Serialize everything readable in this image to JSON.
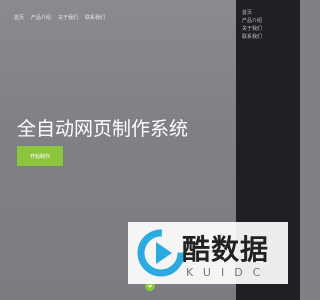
{
  "top_nav": {
    "items": [
      {
        "label": "首页"
      },
      {
        "label": "产品介绍"
      },
      {
        "label": "关于我们"
      },
      {
        "label": "联系我们"
      }
    ]
  },
  "hero": {
    "title": "全自动网页制作系统",
    "button_label": "开始制作"
  },
  "drawer_menu": {
    "items": [
      {
        "label": "首页"
      },
      {
        "label": "产品介绍"
      },
      {
        "label": "关于我们"
      },
      {
        "label": "联系我们"
      }
    ]
  },
  "watermark": {
    "brand": "酷数据",
    "sub": "KUIDC"
  },
  "colors": {
    "accent": "#8cc63f",
    "drawer_bg": "#1f2023",
    "hero_bg": "#808186"
  },
  "icons": {
    "scroll": "chevron-down-icon",
    "logo": "play-logo-icon"
  }
}
